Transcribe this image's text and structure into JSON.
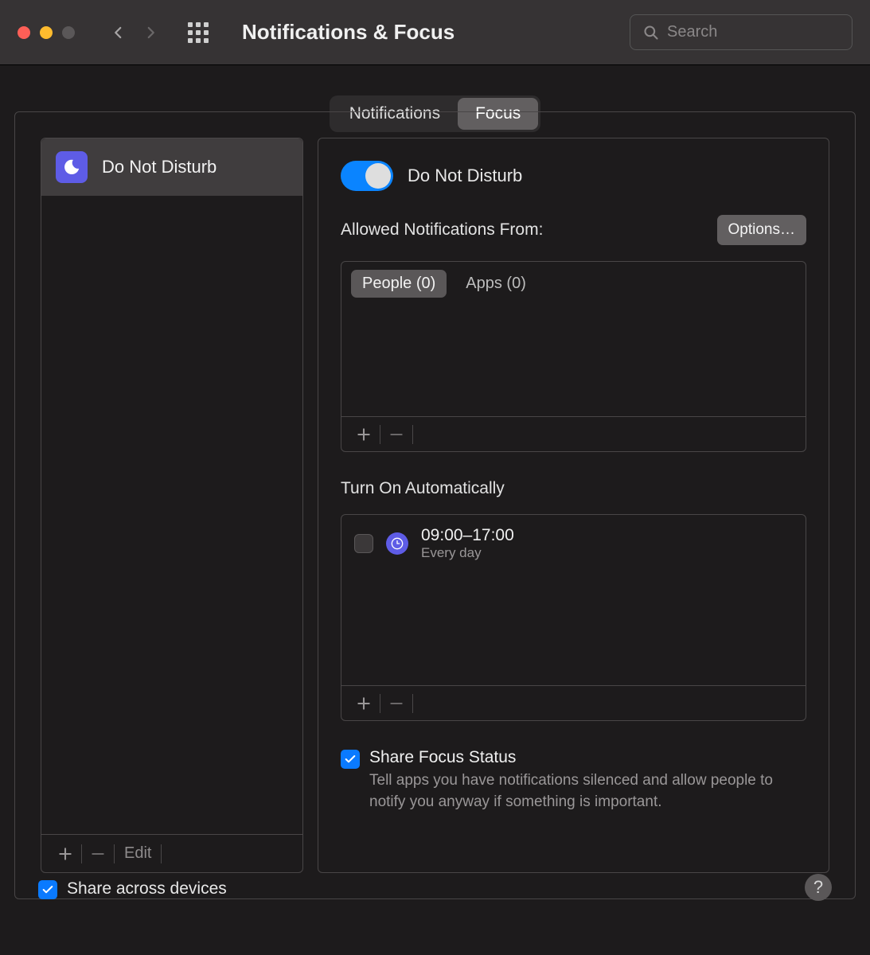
{
  "window": {
    "title": "Notifications & Focus",
    "search_placeholder": "Search"
  },
  "tabs": {
    "notifications": "Notifications",
    "focus": "Focus"
  },
  "sidebar": {
    "items": [
      {
        "label": "Do Not Disturb"
      }
    ],
    "edit_label": "Edit"
  },
  "detail": {
    "toggle_label": "Do Not Disturb",
    "allowed_title": "Allowed Notifications From:",
    "options_label": "Options…",
    "allowed_tabs": {
      "people": "People (0)",
      "apps": "Apps (0)"
    },
    "auto_title": "Turn On Automatically",
    "schedule": {
      "time": "09:00–17:00",
      "sub": "Every day"
    },
    "share_status": {
      "label": "Share Focus Status",
      "desc": "Tell apps you have notifications silenced and allow people to notify you anyway if something is important."
    }
  },
  "footer": {
    "share_devices": "Share across devices"
  }
}
